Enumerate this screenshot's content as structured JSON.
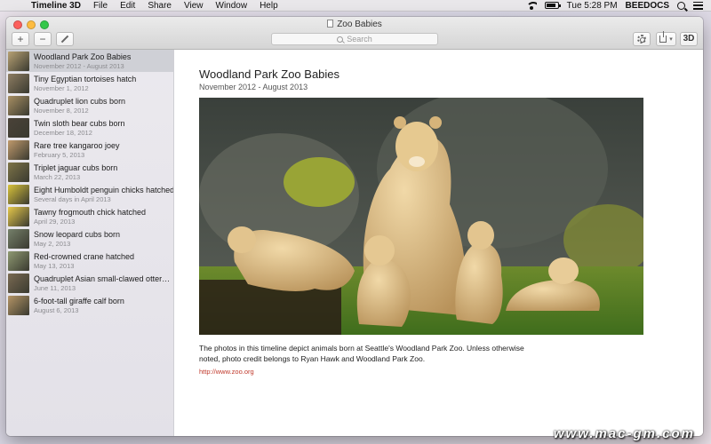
{
  "menubar": {
    "app_name": "Timeline 3D",
    "menus": [
      "File",
      "Edit",
      "Share",
      "View",
      "Window",
      "Help"
    ],
    "clock": "Tue 5:28 PM",
    "user": "BEEDOCS",
    "status_icons": [
      "wifi-icon",
      "battery-icon",
      "spotlight-icon",
      "notification-center-icon"
    ]
  },
  "window": {
    "title": "Zoo Babies",
    "search_placeholder": "Search",
    "toolbar": {
      "add_label": "+",
      "remove_label": "−",
      "three_d_label": "3D"
    }
  },
  "sidebar": {
    "items": [
      {
        "title": "Woodland Park Zoo Babies",
        "date": "November 2012 - August 2013",
        "selected": true,
        "thumb_color": "#b8a274"
      },
      {
        "title": "Tiny Egyptian tortoises hatch",
        "date": "November 1, 2012",
        "thumb_color": "#8e7d62"
      },
      {
        "title": "Quadruplet lion cubs born",
        "date": "November 8, 2012",
        "thumb_color": "#a88f63"
      },
      {
        "title": "Twin sloth bear cubs born",
        "date": "December 18, 2012",
        "thumb_color": "#4a4238"
      },
      {
        "title": "Rare tree kangaroo joey",
        "date": "February 5, 2013",
        "thumb_color": "#c09a6c"
      },
      {
        "title": "Triplet jaguar cubs born",
        "date": "March 22, 2013",
        "thumb_color": "#7e7448"
      },
      {
        "title": "Eight Humboldt penguin chicks hatched",
        "date": "Several days in April 2013",
        "thumb_color": "#d8c23a"
      },
      {
        "title": "Tawny frogmouth chick hatched",
        "date": "April 29, 2013",
        "thumb_color": "#e6c84a"
      },
      {
        "title": "Snow leopard cubs born",
        "date": "May 2, 2013",
        "thumb_color": "#75806a"
      },
      {
        "title": "Red-crowned crane hatched",
        "date": "May 13, 2013",
        "thumb_color": "#8f9a72"
      },
      {
        "title": "Quadruplet Asian small-clawed otter…",
        "date": "June 11, 2013",
        "thumb_color": "#7a6a52"
      },
      {
        "title": "6-foot-tall giraffe calf born",
        "date": "August 6, 2013",
        "thumb_color": "#b59566"
      }
    ]
  },
  "content": {
    "title": "Woodland Park Zoo Babies",
    "date": "November 2012 - August 2013",
    "description": "The photos in this timeline depict animals born at Seattle's Woodland Park Zoo. Unless otherwise noted, photo credit belongs to Ryan Hawk and Woodland Park Zoo.",
    "url": "http://www.zoo.org"
  },
  "watermark": "www.mac-gm.com"
}
